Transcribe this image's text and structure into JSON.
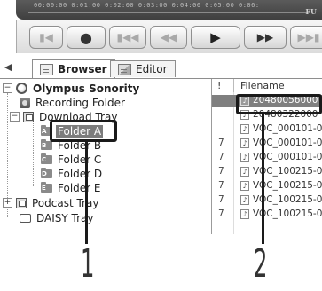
{
  "timeline": {
    "ticks": "00:00:00   0:01:00   0:02:00   0:03:00   0:04:00   0:05:00   0:06:",
    "corner_label": "FU"
  },
  "transport": {
    "buttons": [
      {
        "name": "goto-start-button",
        "icon": "skip-start-icon",
        "glyph": "⏮",
        "disabled": true
      },
      {
        "name": "record-button",
        "icon": "record-icon",
        "glyph": "●",
        "disabled": false
      },
      {
        "name": "previous-button",
        "icon": "previous-icon",
        "glyph": "⏮",
        "disabled": true
      },
      {
        "name": "rewind-button",
        "icon": "rewind-icon",
        "glyph": "◀◀",
        "disabled": true
      },
      {
        "name": "play-button",
        "icon": "play-icon",
        "glyph": "▶",
        "disabled": false
      },
      {
        "name": "fast-forward-button",
        "icon": "fast-forward-icon",
        "glyph": "▶▶",
        "disabled": false
      },
      {
        "name": "next-button",
        "icon": "next-icon",
        "glyph": "⏭",
        "disabled": true
      }
    ]
  },
  "tabs": {
    "browser": "Browser",
    "editor": "Editor"
  },
  "tree": {
    "root": "Olympus Sonority",
    "recording_folder": "Recording Folder",
    "download_tray": "Download Tray",
    "folders": [
      {
        "label": "Folder A",
        "letter": "A",
        "selected": true
      },
      {
        "label": "Folder B",
        "letter": "B",
        "selected": false
      },
      {
        "label": "Folder C",
        "letter": "C",
        "selected": false
      },
      {
        "label": "Folder D",
        "letter": "D",
        "selected": false
      },
      {
        "label": "Folder E",
        "letter": "E",
        "selected": false
      }
    ],
    "podcast_tray": "Podcast Tray",
    "daisy_tray": "DAISY Tray"
  },
  "filelist": {
    "col_flag": "!",
    "col_name": "Filename",
    "rows": [
      {
        "flag": "",
        "name": "20480056000",
        "selected": true
      },
      {
        "flag": "",
        "name": "20480322000",
        "selected": false
      },
      {
        "flag": "",
        "name": "VOC_000101-0",
        "selected": false
      },
      {
        "flag": "7",
        "name": "VOC_000101-0",
        "selected": false
      },
      {
        "flag": "7",
        "name": "VOC_000101-0",
        "selected": false
      },
      {
        "flag": "7",
        "name": "VOC_100215-0",
        "selected": false
      },
      {
        "flag": "7",
        "name": "VOC_100215-0",
        "selected": false
      },
      {
        "flag": "7",
        "name": "VOC_100215-0",
        "selected": false
      },
      {
        "flag": "7",
        "name": "VOC_100215-0",
        "selected": false
      }
    ]
  },
  "callouts": [
    {
      "number": "1"
    },
    {
      "number": "2"
    }
  ],
  "colors": {
    "selection": "#7f7f7f",
    "callout": "#1a1a1a"
  }
}
